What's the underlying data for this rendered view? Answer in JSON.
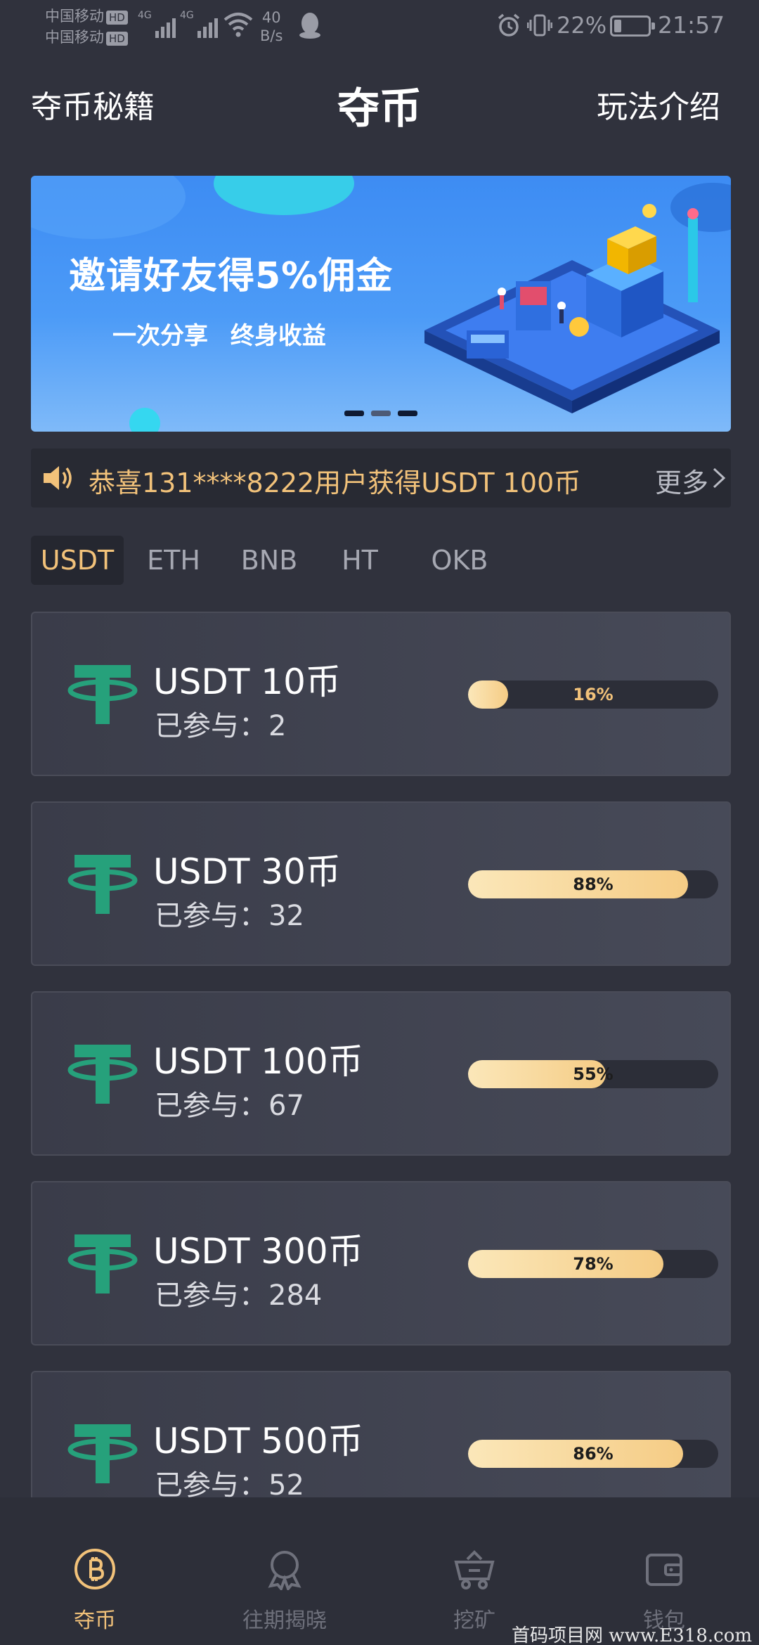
{
  "status_bar": {
    "carrier_1": "中国移动",
    "carrier_2": "中国移动",
    "hd_badge": "HD",
    "network_1": "4G",
    "network_2": "4G",
    "speed_value": "40",
    "speed_unit": "B/s",
    "battery": "22%",
    "battery_level": 0.22,
    "time": "21:57"
  },
  "header": {
    "left_link": "夺币秘籍",
    "title": "夺币",
    "right_link": "玩法介绍"
  },
  "banner": {
    "headline": "邀请好友得5%佣金",
    "subline": "一次分享 终身收益",
    "slide_count": 3,
    "active_slide": 1
  },
  "notice": {
    "text": "恭喜131****8222用户获得USDT 100币",
    "more": "更多"
  },
  "tabs": [
    {
      "label": "USDT",
      "active": true
    },
    {
      "label": "ETH",
      "active": false
    },
    {
      "label": "BNB",
      "active": false
    },
    {
      "label": "HT",
      "active": false
    },
    {
      "label": "OKB",
      "active": false
    }
  ],
  "joined_label": "已参与：",
  "items": [
    {
      "name": "USDT 10币",
      "joined": "2",
      "progress": 16,
      "progress_label": "16%"
    },
    {
      "name": "USDT 30币",
      "joined": "32",
      "progress": 88,
      "progress_label": "88%"
    },
    {
      "name": "USDT 100币",
      "joined": "67",
      "progress": 55,
      "progress_label": "55%"
    },
    {
      "name": "USDT 300币",
      "joined": "284",
      "progress": 78,
      "progress_label": "78%"
    },
    {
      "name": "USDT 500币",
      "joined": "52",
      "progress": 86,
      "progress_label": "86%"
    }
  ],
  "bottom_nav": [
    {
      "label": "夺币",
      "icon": "bitcoin-icon",
      "active": true
    },
    {
      "label": "往期揭晓",
      "icon": "medal-icon",
      "active": false
    },
    {
      "label": "挖矿",
      "icon": "mine-cart-icon",
      "active": false
    },
    {
      "label": "钱包",
      "icon": "wallet-icon",
      "active": false
    }
  ],
  "watermark": "首码项目网 www.E318.com",
  "colors": {
    "background": "#30323d",
    "accent_gold": "#f2c27a",
    "tether_green": "#26a17b",
    "progress_fill": "#f5cc85"
  }
}
